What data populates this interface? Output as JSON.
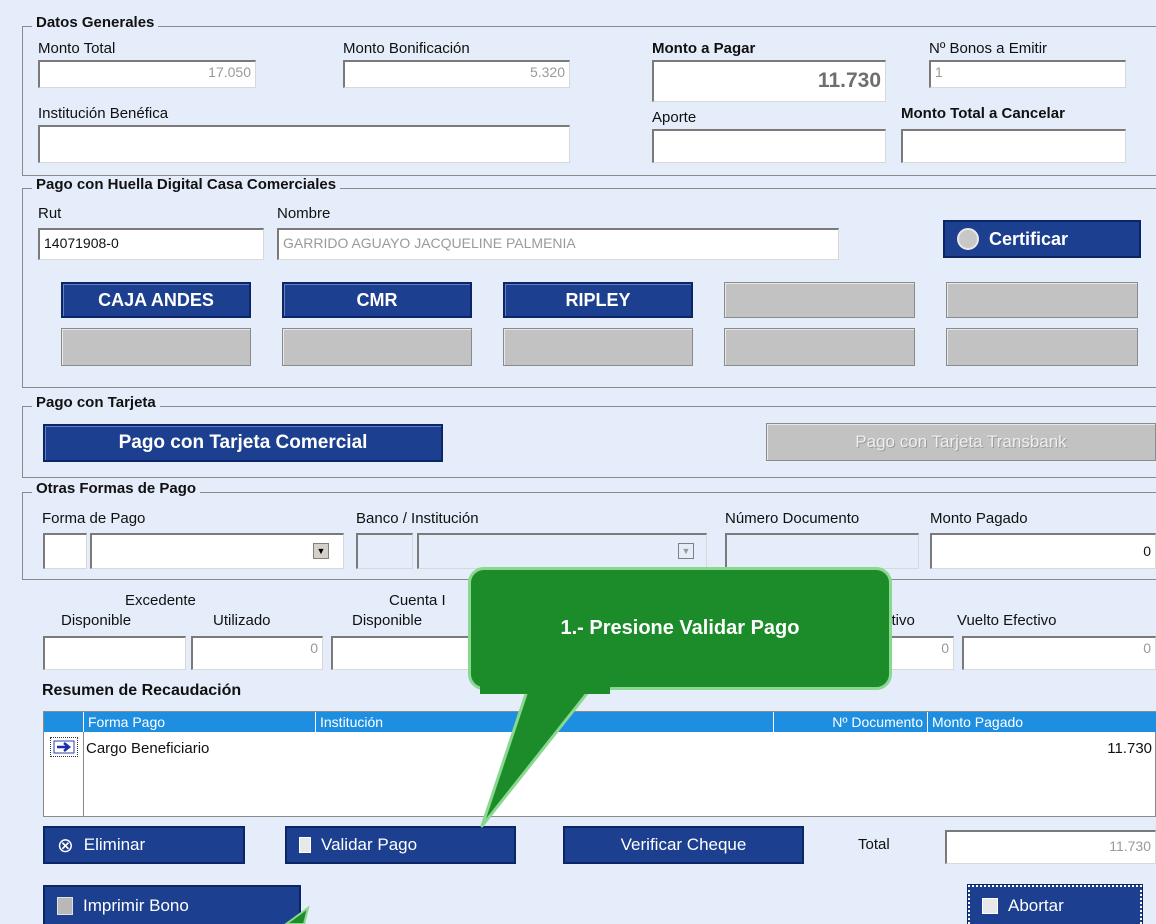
{
  "datos_generales": {
    "legend": "Datos Generales",
    "monto_total": {
      "label": "Monto Total",
      "value": "17.050"
    },
    "monto_bonificacion": {
      "label": "Monto Bonificación",
      "value": "5.320"
    },
    "monto_a_pagar": {
      "label": "Monto a Pagar",
      "value": "11.730"
    },
    "n_bonos": {
      "label": "Nº Bonos a Emitir",
      "value": "1"
    },
    "institucion": {
      "label": "Institución Benéfica",
      "value": ""
    },
    "aporte": {
      "label": "Aporte",
      "value": ""
    },
    "monto_total_cancelar": {
      "label": "Monto Total a Cancelar",
      "value": ""
    }
  },
  "huella": {
    "legend": "Pago con Huella Digital Casa Comerciales",
    "rut": {
      "label": "Rut",
      "value": "14071908-0"
    },
    "nombre": {
      "label": "Nombre",
      "value": "GARRIDO AGUAYO JACQUELINE PALMENIA"
    },
    "certificar_label": "Certificar",
    "casas": [
      "CAJA ANDES",
      "CMR",
      "RIPLEY"
    ]
  },
  "tarjeta": {
    "legend": "Pago con Tarjeta",
    "comercial_label": "Pago con Tarjeta Comercial",
    "transbank_label": "Pago con Tarjeta Transbank"
  },
  "otras": {
    "legend": "Otras Formas de Pago",
    "forma_pago_label": "Forma de Pago",
    "banco_label": "Banco / Institución",
    "numero_doc_label": "Número  Documento",
    "monto_pagado_label": "Monto Pagado",
    "monto_pagado_value": "0"
  },
  "excedente": {
    "excedente_label": "Excedente",
    "cuenta_label": "Cuenta I",
    "disponible_label": "Disponible",
    "utilizado_label": "Utilizado",
    "utilizado_value": "0",
    "disponible2_label": "Disponible",
    "efectivo_label": "ctivo",
    "efectivo_value": "0",
    "vuelto_label": "Vuelto Efectivo",
    "vuelto_value": "0"
  },
  "resumen": {
    "title": "Resumen de Recaudación",
    "columns": [
      "Forma Pago",
      "Institución",
      "Nº Documento",
      "Monto Pagado"
    ],
    "rows": [
      {
        "forma": "Cargo Beneficiario",
        "monto": "11.730"
      }
    ]
  },
  "actions": {
    "eliminar": "Eliminar",
    "validar": "Validar Pago",
    "verificar": "Verificar Cheque",
    "total_label": "Total",
    "total_value": "11.730",
    "imprimir": "Imprimir Bono",
    "abortar": "Abortar"
  },
  "callout": "1.- Presione Validar Pago",
  "colors": {
    "panel": "#e4edf9",
    "button_blue": "#1d3f8f",
    "grid_header": "#1e8ee0",
    "callout_green": "#1c8c2a"
  }
}
